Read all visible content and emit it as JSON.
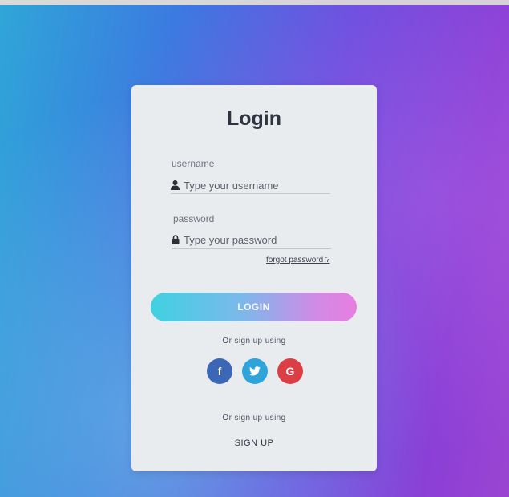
{
  "login": {
    "title": "Login",
    "username_label": "username",
    "username_placeholder": "Type your username",
    "password_label": "password",
    "password_placeholder": "Type your password",
    "forgot_link": "forgot password ?",
    "login_button": "LOGIN",
    "signup_using_1": "Or sign up using",
    "signup_using_2": "Or sign up using",
    "signup_link": "SIGN UP"
  },
  "social": {
    "facebook": "f",
    "google": "G"
  },
  "colors": {
    "facebook": "#3b67b6",
    "twitter": "#2fa4db",
    "google": "#db3f45"
  }
}
